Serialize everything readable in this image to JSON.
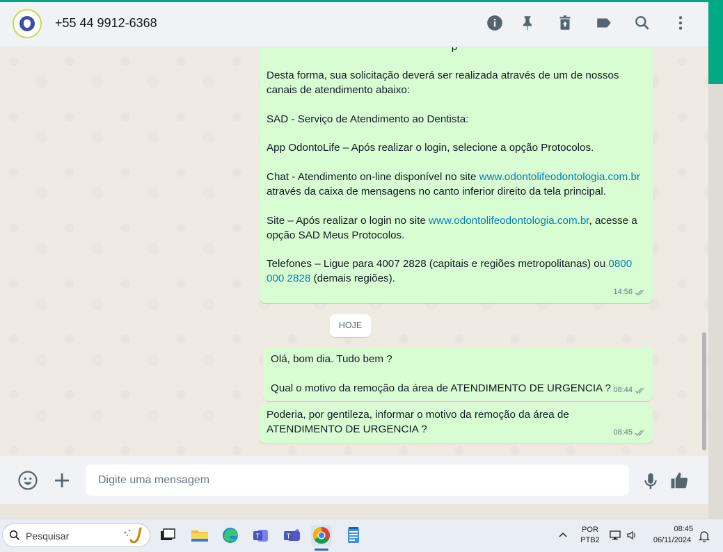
{
  "header": {
    "contact_name": "+55 44 9912-6368"
  },
  "messages": {
    "m1": {
      "partial_top": "p",
      "p1": "Desta forma, sua solicitação deverá ser realizada através de um de nossos canais de atendimento abaixo:",
      "p2": "SAD - Serviço de Atendimento ao Dentista:",
      "p3": "App OdontoLife – Após realizar o login, selecione a opção Protocolos.",
      "p4_a": "Chat - Atendimento on-line disponível no site ",
      "p4_link": "www.odontolifeodontologia.com.br",
      "p4_b": " através da caixa de mensagens no canto inferior direito da tela principal.",
      "p5_a": "Site – Após realizar o login no site ",
      "p5_link": "www.odontolifeodontologia.com.br",
      "p5_b": ", acesse a opção SAD Meus Protocolos.",
      "p6_a": "Telefones – Ligue para 4007 2828 (capitais e regiões metropolitanas) ou ",
      "p6_link": "0800 000 2828",
      "p6_b": " (demais regiões).",
      "time": "14:56"
    },
    "date_chip": "HOJE",
    "m2": {
      "p1": "Olá, bom dia. Tudo bem ?",
      "p2": "Qual o motivo da remoção da área de ATENDIMENTO DE URGENCIA ?",
      "time": "08:44"
    },
    "m3": {
      "p1": "Poderia, por gentileza, informar o motivo da remoção da área de ATENDIMENTO DE URGENCIA ?",
      "time": "08:45"
    }
  },
  "composer": {
    "placeholder": "Digite uma mensagem"
  },
  "taskbar": {
    "search_label": "Pesquisar",
    "lang_line1": "POR",
    "lang_line2": "PTB2",
    "time": "08:45",
    "date": "06/11/2024"
  },
  "colors": {
    "accent": "#00a884",
    "outgoing_bubble": "#d9fdd3",
    "link": "#027eb5"
  }
}
